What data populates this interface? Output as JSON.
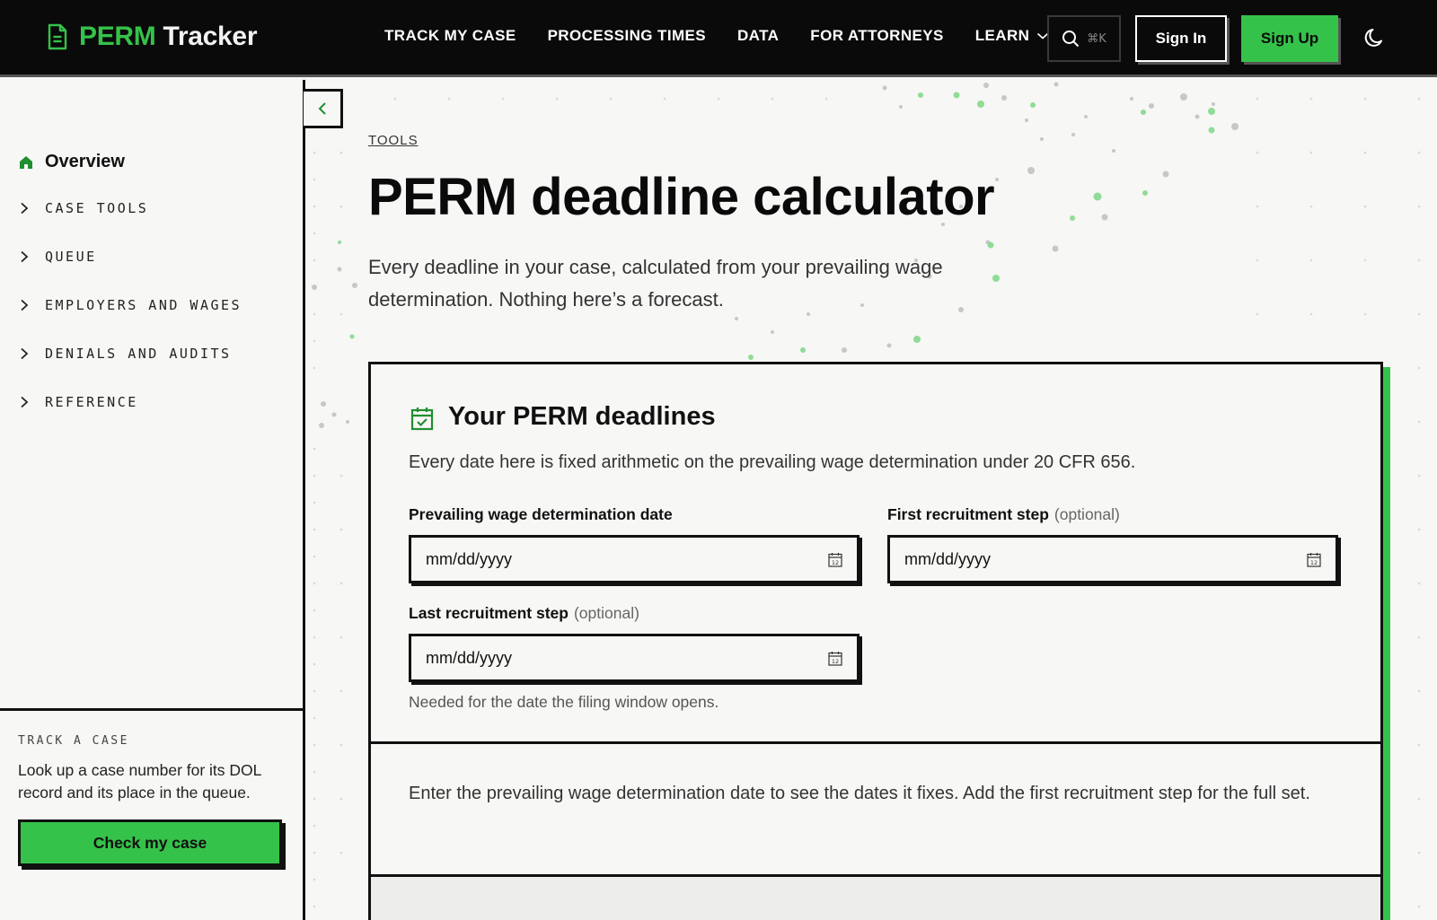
{
  "header": {
    "logo_part1": "PERM",
    "logo_part2": "Tracker",
    "nav": [
      {
        "label": "TRACK MY CASE"
      },
      {
        "label": "PROCESSING TIMES"
      },
      {
        "label": "DATA"
      },
      {
        "label": "FOR ATTORNEYS"
      },
      {
        "label": "LEARN"
      }
    ],
    "search_shortcut": "⌘K",
    "sign_in": "Sign In",
    "sign_up": "Sign Up"
  },
  "sidebar": {
    "overview": "Overview",
    "items": [
      {
        "label": "CASE TOOLS"
      },
      {
        "label": "QUEUE"
      },
      {
        "label": "EMPLOYERS AND WAGES"
      },
      {
        "label": "DENIALS AND AUDITS"
      },
      {
        "label": "REFERENCE"
      }
    ],
    "track": {
      "label": "TRACK A CASE",
      "description": "Look up a case number for its DOL record and its place in the queue.",
      "button": "Check my case"
    }
  },
  "main": {
    "breadcrumb": "TOOLS",
    "title": "PERM deadline calculator",
    "description": "Every deadline in your case, calculated from your prevailing wage determination. Nothing here’s a forecast."
  },
  "card": {
    "title": "Your PERM deadlines",
    "description": "Every date here is fixed arithmetic on the prevailing wage determination under 20 CFR 656.",
    "fields": {
      "pwd": {
        "label": "Prevailing wage determination date",
        "placeholder": "mm/dd/yyyy"
      },
      "first": {
        "label": "First recruitment step",
        "optional": "(optional)",
        "placeholder": "mm/dd/yyyy"
      },
      "last": {
        "label": "Last recruitment step",
        "optional": "(optional)",
        "placeholder": "mm/dd/yyyy"
      }
    },
    "help": "Needed for the date the filing window opens.",
    "result_message": "Enter the prevailing wage determination date to see the dates it fixes. Add the first recruitment step for the full set."
  },
  "colors": {
    "accent": "#35c24a",
    "header_bg": "#0a0a0a",
    "page_bg": "#f7f7f5"
  },
  "icons": [
    "document-icon",
    "chevron-down-icon",
    "search-icon",
    "moon-icon",
    "home-icon",
    "chevron-right-icon",
    "chevron-left-icon",
    "calendar-check-icon",
    "calendar-icon"
  ]
}
